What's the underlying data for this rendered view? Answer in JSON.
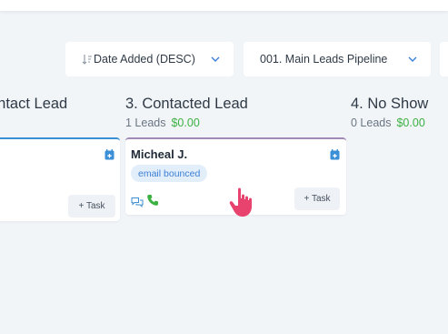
{
  "toolbar": {
    "sort_label": "Date Added (DESC)",
    "pipeline_label": "001. Main Leads Pipeline"
  },
  "columns": [
    {
      "title": "ontact Lead",
      "leads": "",
      "amount": ""
    },
    {
      "title": "3. Contacted Lead",
      "leads": "1 Leads",
      "amount": "$0.00"
    },
    {
      "title": "4. No Show",
      "leads": "0 Leads",
      "amount": "$0.00"
    }
  ],
  "cards": {
    "left": {
      "task_label": "+ Task"
    },
    "mid": {
      "name": "Micheal J.",
      "tag": "email bounced",
      "task_label": "+ Task"
    }
  },
  "colors": {
    "background": "#f1f5f8",
    "accent_blue": "#3b8fd6",
    "accent_purple": "#a08bb8",
    "amount_green": "#3cb043",
    "cursor_pink": "#e8436f"
  },
  "icons": [
    "sort-icon",
    "chevron-down-icon",
    "calendar-icon",
    "chat-icon",
    "phone-icon",
    "hand-pointer-icon"
  ]
}
